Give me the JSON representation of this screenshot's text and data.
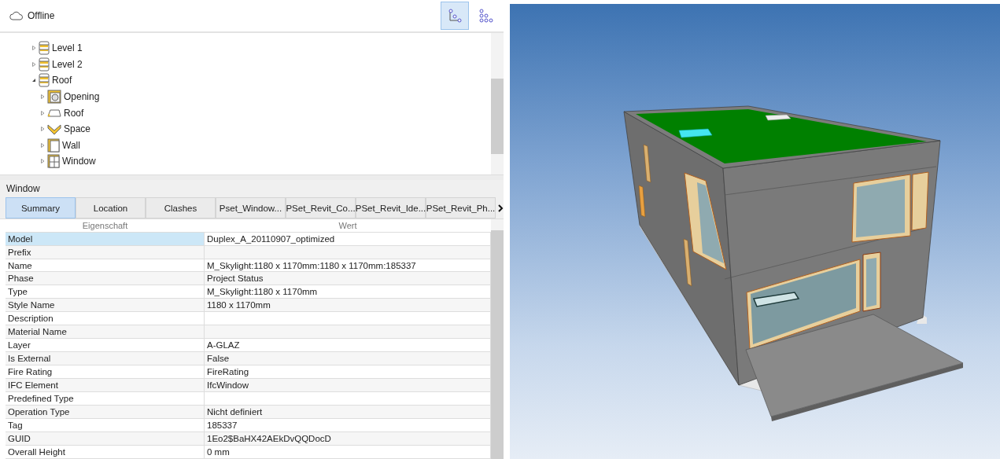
{
  "header": {
    "status": "Offline",
    "view_buttons": [
      {
        "kind": "tree",
        "selected": true
      },
      {
        "kind": "grid",
        "selected": false
      }
    ]
  },
  "tree": [
    {
      "label": "Level 1",
      "kind": "level",
      "expanded": false
    },
    {
      "label": "Level 2",
      "kind": "level",
      "expanded": false
    },
    {
      "label": "Roof",
      "kind": "level",
      "expanded": true,
      "children": [
        {
          "label": "Opening",
          "kind": "opening",
          "expanded": false
        },
        {
          "label": "Roof",
          "kind": "roof",
          "expanded": false
        },
        {
          "label": "Space",
          "kind": "space",
          "expanded": false
        },
        {
          "label": "Wall",
          "kind": "wall",
          "expanded": false
        },
        {
          "label": "Window",
          "kind": "window",
          "expanded": false
        }
      ]
    }
  ],
  "properties": {
    "title": "Window",
    "tabs": [
      {
        "label": "Summary",
        "selected": true
      },
      {
        "label": "Location",
        "selected": false
      },
      {
        "label": "Clashes",
        "selected": false
      },
      {
        "label": "Pset_Window...",
        "selected": false
      },
      {
        "label": "PSet_Revit_Co...",
        "selected": false
      },
      {
        "label": "PSet_Revit_Ide...",
        "selected": false
      },
      {
        "label": "PSet_Revit_Ph...",
        "selected": false
      }
    ],
    "columns": [
      "Eigenschaft",
      "Wert"
    ],
    "rows": [
      {
        "property": "Model",
        "value": "Duplex_A_20110907_optimized",
        "selected": true
      },
      {
        "property": "Prefix",
        "value": "",
        "selected": false
      },
      {
        "property": "Name",
        "value": "M_Skylight:1180 x 1170mm:1180 x 1170mm:185337",
        "selected": false
      },
      {
        "property": "Phase",
        "value": "Project Status",
        "selected": false
      },
      {
        "property": "Type",
        "value": "M_Skylight:1180 x 1170mm",
        "selected": false
      },
      {
        "property": "Style Name",
        "value": "1180 x 1170mm",
        "selected": false
      },
      {
        "property": "Description",
        "value": "",
        "selected": false
      },
      {
        "property": "Material Name",
        "value": "",
        "selected": false
      },
      {
        "property": "Layer",
        "value": "A-GLAZ",
        "selected": false
      },
      {
        "property": "Is External",
        "value": "False",
        "selected": false
      },
      {
        "property": "Fire Rating",
        "value": "FireRating",
        "selected": false
      },
      {
        "property": "IFC Element",
        "value": "IfcWindow",
        "selected": false
      },
      {
        "property": "Predefined Type",
        "value": "",
        "selected": false
      },
      {
        "property": "Operation Type",
        "value": "Nicht definiert",
        "selected": false
      },
      {
        "property": "Tag",
        "value": "185337",
        "selected": false
      },
      {
        "property": "GUID",
        "value": "1Eo2$BaHX42AEkDvQQDocD",
        "selected": false
      },
      {
        "property": "Overall Height",
        "value": "0 mm",
        "selected": false
      }
    ]
  }
}
